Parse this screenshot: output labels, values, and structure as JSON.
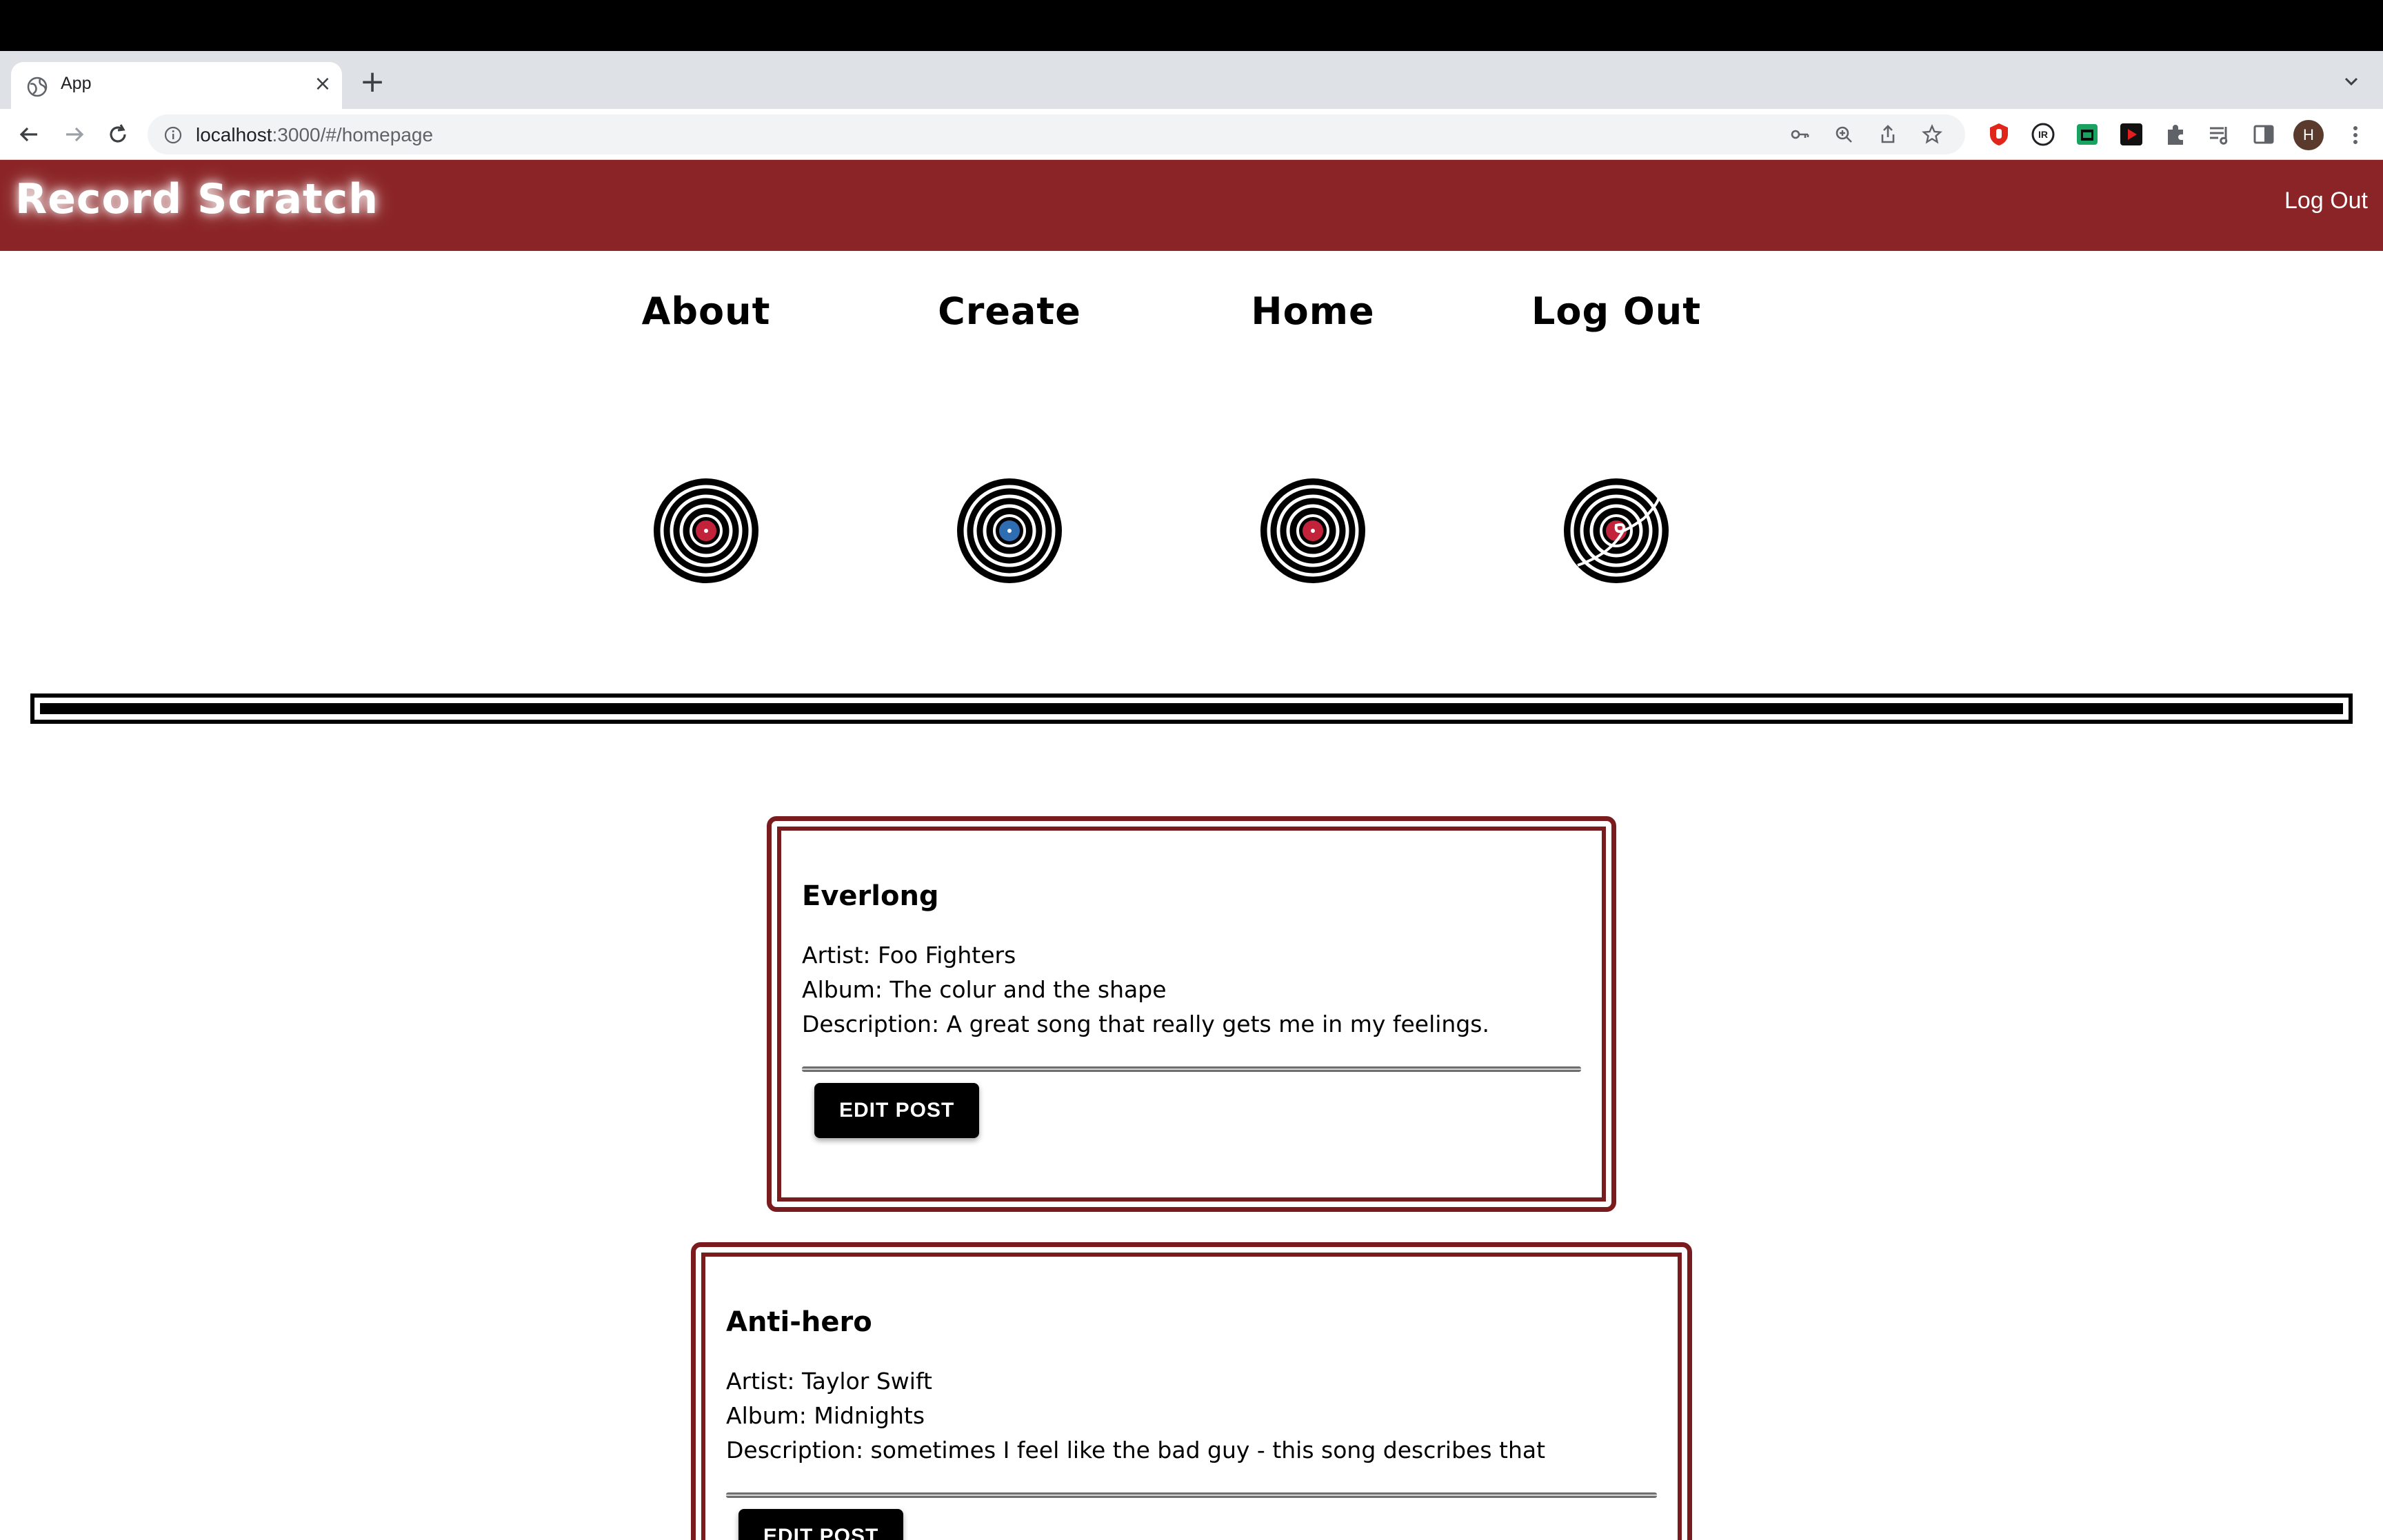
{
  "browser": {
    "tab_title": "App",
    "tab_close": "×",
    "new_tab": "+",
    "url_host": "localhost",
    "url_path": ":3000/#/homepage",
    "avatar_letter": "H"
  },
  "header": {
    "brand": "Record Scratch",
    "logout": "Log Out",
    "color": "#8b2426"
  },
  "nav": {
    "items": [
      {
        "label": "About",
        "record_center": "#c2233a"
      },
      {
        "label": "Create",
        "record_center": "#2f6db3"
      },
      {
        "label": "Home",
        "record_center": "#c2233a"
      },
      {
        "label": "Log Out",
        "record_center": "#c2233a",
        "scratched": true
      }
    ]
  },
  "posts": [
    {
      "title": "Everlong",
      "artist": "Artist: Foo Fighters",
      "album": "Album: The colur and the shape",
      "description": "Description: A great song that really gets me in my feelings.",
      "button": "EDIT POST"
    },
    {
      "title": "Anti-hero",
      "artist": "Artist: Taylor Swift",
      "album": "Album: Midnights",
      "description": "Description: sometimes I feel like the bad guy - this song describes that",
      "button": "EDIT POST"
    }
  ]
}
